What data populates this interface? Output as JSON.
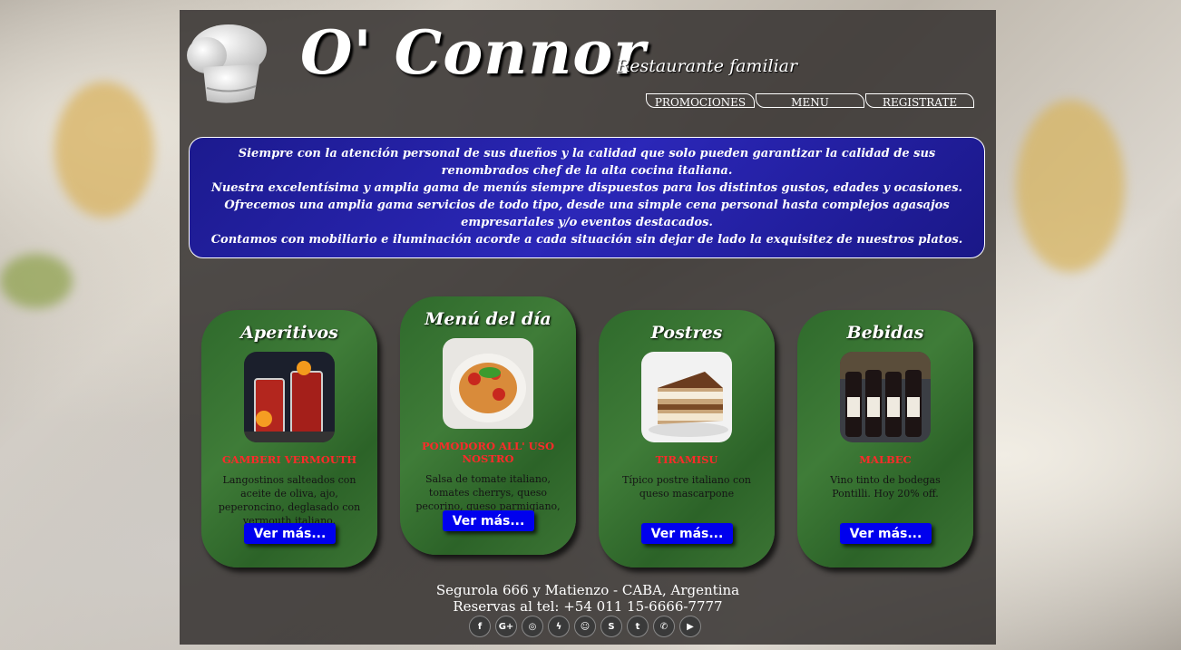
{
  "brand": {
    "name": "O' Connor",
    "tagline": "Restaurante familiar"
  },
  "nav": [
    "PROMOCIONES",
    "MENU",
    "REGISTRATE"
  ],
  "intro": [
    "Siempre con la atención personal de sus dueños y la calidad que solo pueden garantizar la calidad de sus renombrados chef de la alta cocina italiana.",
    "Nuestra excelentísima y amplia gama de menús siempre dispuestos para los distintos gustos, edades y ocasiones.",
    "Ofrecemos una amplia gama servicios de todo tipo, desde una simple cena personal hasta complejos agasajos empresariales y/o eventos destacados.",
    "Contamos con mobiliario e iluminación acorde a cada situación sin dejar de lado la exquisitez de nuestros platos."
  ],
  "cards": [
    {
      "title": "Aperitivos",
      "dish": "GAMBERI VERMOUTH",
      "desc": "Langostinos salteados con aceite de oliva, ajo, peperoncino, deglasado con vermouth italiano.",
      "button": "Ver más..."
    },
    {
      "title": "Menú del día",
      "dish": "POMODORO ALL' USO NOSTRO",
      "desc": "Salsa de tomate italiano, tomates cherrys, queso pecorino, queso parmigiano, y albahaca fresca",
      "button": "Ver más..."
    },
    {
      "title": "Postres",
      "dish": "TIRAMISU",
      "desc": "Típico postre italiano con queso mascarpone",
      "button": "Ver más..."
    },
    {
      "title": "Bebidas",
      "dish": "MALBEC",
      "desc": "Vino tinto de bodegas Pontilli. Hoy 20% off.",
      "button": "Ver más..."
    }
  ],
  "footer": {
    "address": "Segurola 666 y Matienzo - CABA, Argentina",
    "phone": "Reservas al tel: +54 011 15-6666-7777"
  },
  "social_icons": [
    "facebook-icon",
    "google-plus-icon",
    "instagram-icon",
    "messenger-icon",
    "snapchat-icon",
    "skype-icon",
    "twitter-icon",
    "whatsapp-icon",
    "youtube-icon"
  ],
  "colors": {
    "intro_bg": "#2b27b8",
    "card_bg": "#3f7c38",
    "dish_name": "#ff2a2a",
    "button_bg": "#0000ee"
  }
}
